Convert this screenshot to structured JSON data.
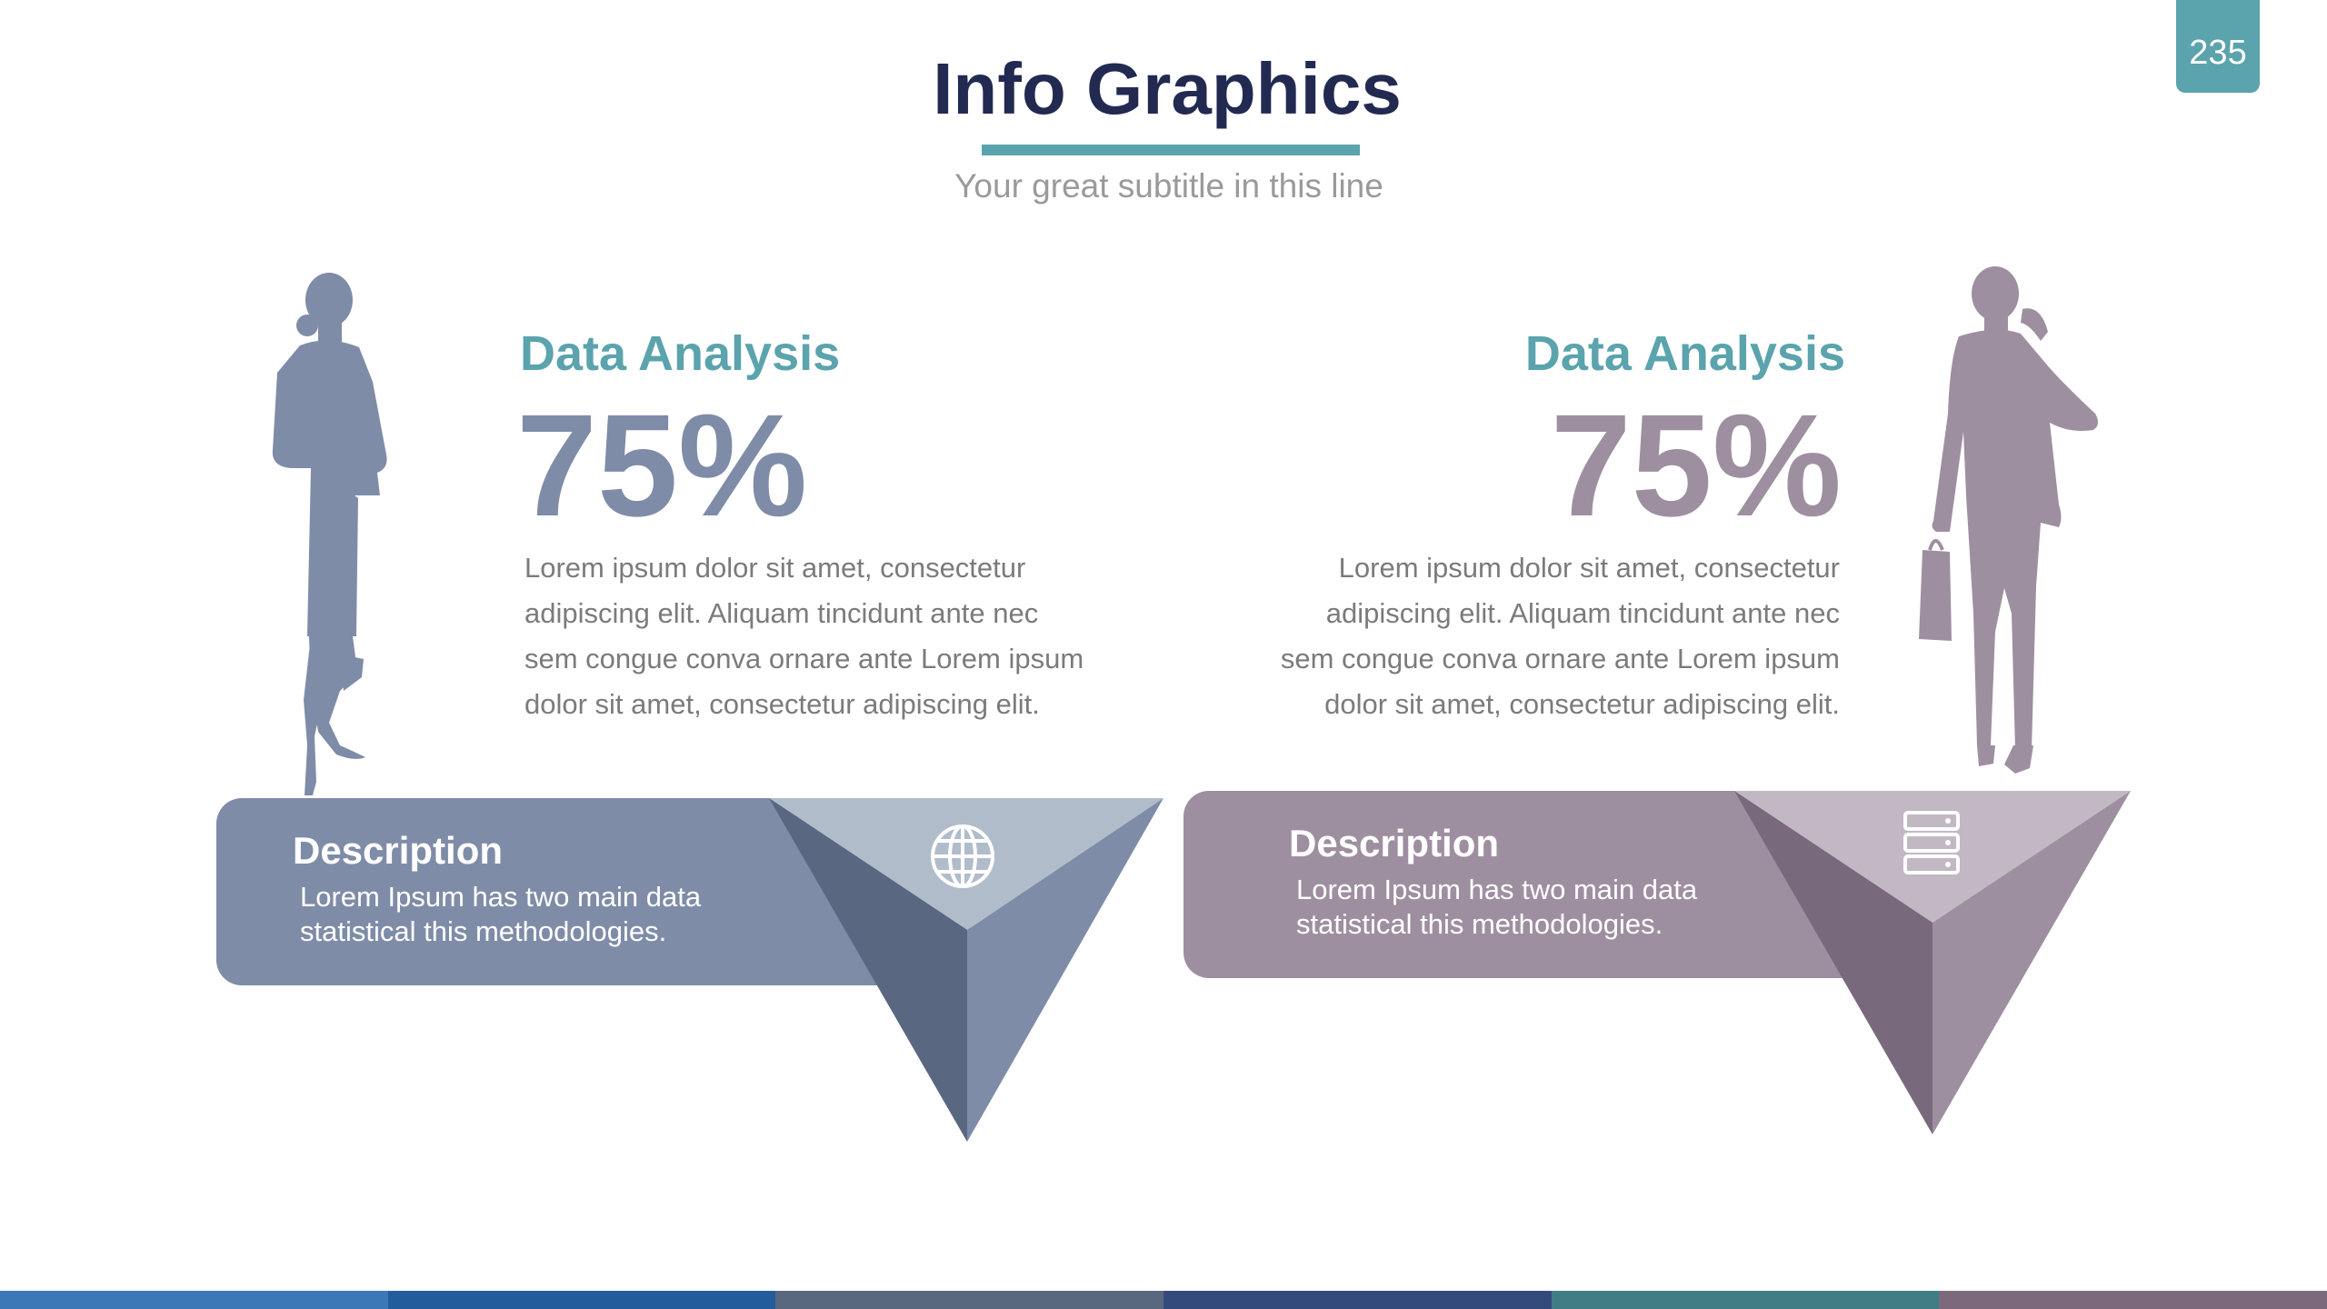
{
  "slide": {
    "title": "Info Graphics",
    "subtitle": "Your great subtitle in this line",
    "page_number": "235"
  },
  "left_panel": {
    "heading": "Data Analysis",
    "percent": "75%",
    "body": "Lorem ipsum dolor sit amet, consectetur adipiscing elit. Aliquam tincidunt ante nec sem congue conva ornare ante Lorem ipsum dolor sit amet, consectetur adipiscing elit.",
    "description_title": "Description",
    "description_text": "Lorem Ipsum has two main data statistical this methodologies.",
    "icon": "globe-icon",
    "silhouette": "businesswoman-silhouette",
    "color": "#7f8ca8"
  },
  "right_panel": {
    "heading": "Data Analysis",
    "percent": "75%",
    "body": "Lorem ipsum dolor sit amet, consectetur adipiscing elit. Aliquam tincidunt ante nec sem congue conva ornare ante Lorem ipsum dolor sit amet, consectetur adipiscing elit.",
    "description_title": "Description",
    "description_text": "Lorem Ipsum has two main data statistical this methodologies.",
    "icon": "server-icon",
    "silhouette": "businessman-silhouette",
    "color": "#9e8fa0"
  },
  "colors": {
    "title": "#222a52",
    "accent": "#5ba3ad",
    "body_text": "#7b7b7b",
    "subtitle": "#9a9a9a",
    "stripe": [
      "#3b78b8",
      "#235c9c",
      "#59687e",
      "#354a7c",
      "#3f7e84",
      "#7c6a7c"
    ]
  }
}
